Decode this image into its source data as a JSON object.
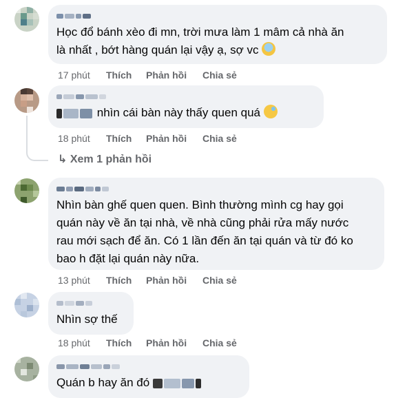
{
  "comments": [
    {
      "text": "Học đổ bánh xèo đi mn, trời mưa làm 1 mâm cả nhà ăn\nlà nhất , bớt hàng quán lại vậy ạ, sợ vc",
      "emoji": "😱",
      "time": "17 phút",
      "like": "Thích",
      "reply": "Phản hồi",
      "share": "Chia sẻ"
    },
    {
      "text": "nhìn cái bàn này thấy quen quá",
      "emoji": "😥",
      "time": "18 phút",
      "like": "Thích",
      "reply": "Phản hồi",
      "share": "Chia sẻ",
      "view_replies": "Xem 1 phản hồi"
    },
    {
      "text": "Nhìn bàn ghế quen quen. Bình thường mình cg hay gọi\nquán này về ăn tại nhà, về nhà cũng phải rửa mấy nước\nrau mới sạch để ăn. Có 1 lần đến ăn tại quán và từ đó ko\nbao h đặt lại quán này nữa.",
      "time": "13 phút",
      "like": "Thích",
      "reply": "Phản hồi",
      "share": "Chia sẻ"
    },
    {
      "text": "Nhìn sợ thế",
      "time": "18 phút",
      "like": "Thích",
      "reply": "Phản hồi",
      "share": "Chia sẻ"
    },
    {
      "text": "Quán b hay ăn đó"
    }
  ],
  "colors": {
    "bubble": "#f0f2f5",
    "meta": "#65676b",
    "text": "#050505"
  },
  "icons": {
    "reply_arrow": "reply-arrow-icon"
  }
}
